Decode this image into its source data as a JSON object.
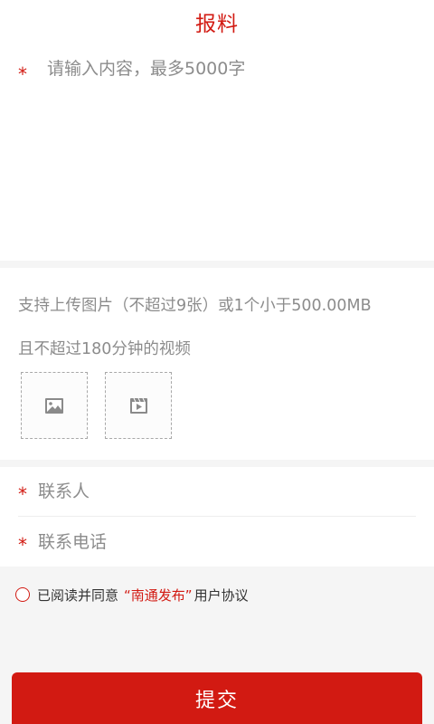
{
  "header": {
    "title": "报料"
  },
  "content": {
    "required_mark": "*",
    "placeholder": "请输入内容，最多5000字"
  },
  "upload": {
    "hint_line1": "支持上传图片（不超过9张）或1个小于500.00MB",
    "hint_line2": "且不超过180分钟的视频",
    "image_icon": "image-icon",
    "video_icon": "video-icon"
  },
  "contact": {
    "name": {
      "required_mark": "*",
      "placeholder": "联系人"
    },
    "phone": {
      "required_mark": "*",
      "placeholder": "联系电话"
    }
  },
  "agreement": {
    "prefix": "已阅读并同意",
    "link": "“南通发布”",
    "suffix": "用户协议"
  },
  "submit": {
    "label": "提交"
  },
  "colors": {
    "accent": "#d21a12",
    "background": "#f5f5f5"
  }
}
